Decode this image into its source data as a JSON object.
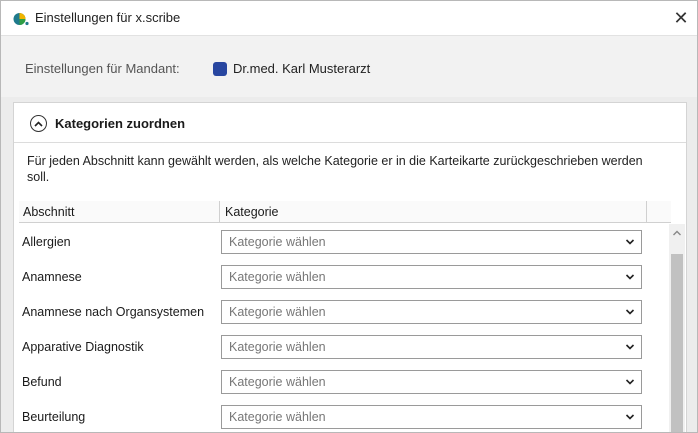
{
  "window": {
    "title": "Einstellungen für x.scribe",
    "close_glyph": "✕"
  },
  "mandant": {
    "label": "Einstellungen für Mandant:",
    "name": "Dr.med. Karl Musterarzt",
    "color": "#2846a0"
  },
  "section": {
    "title": "Kategorien zuordnen",
    "description": "Für jeden Abschnitt kann gewählt werden, als welche Kategorie er in die Karteikarte zurückgeschrieben werden soll."
  },
  "table": {
    "headers": [
      "Abschnitt",
      "Kategorie"
    ],
    "rows": [
      {
        "label": "Allergien",
        "value": "Kategorie wählen"
      },
      {
        "label": "Anamnese",
        "value": "Kategorie wählen"
      },
      {
        "label": "Anamnese nach Organsystemen",
        "value": "Kategorie wählen"
      },
      {
        "label": "Apparative Diagnostik",
        "value": "Kategorie wählen"
      },
      {
        "label": "Befund",
        "value": "Kategorie wählen"
      },
      {
        "label": "Beurteilung",
        "value": "Kategorie wählen"
      }
    ]
  },
  "icons": {
    "app": "xscribe-logo-icon",
    "collapse": "chevron-up-circle-icon",
    "dropdown": "chevron-down-icon",
    "scroll_up": "scroll-up-arrow-icon",
    "close": "close-icon"
  }
}
